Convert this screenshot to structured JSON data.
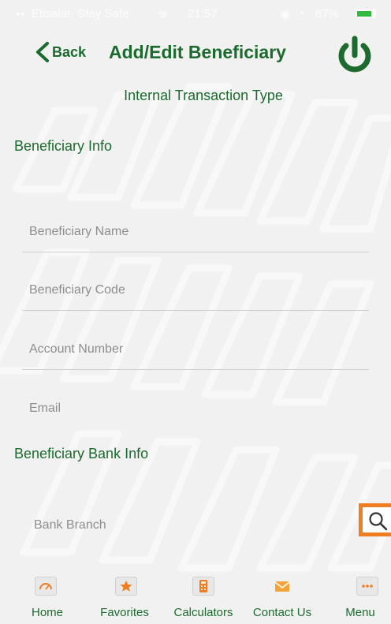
{
  "status_bar": {
    "carrier": "Etisalat- Stay Safe",
    "time": "21:57",
    "battery": "87%"
  },
  "header": {
    "back_label": "Back",
    "title": "Add/Edit Beneficiary"
  },
  "subtitle": "Internal Transaction Type",
  "sections": {
    "beneficiary_info": {
      "title": "Beneficiary Info",
      "fields": [
        {
          "placeholder": "Beneficiary Name"
        },
        {
          "placeholder": "Beneficiary Code"
        },
        {
          "placeholder": "Account Number"
        },
        {
          "placeholder": "Email"
        }
      ]
    },
    "bank_info": {
      "title": "Beneficiary Bank Info",
      "fields": [
        {
          "placeholder": "Bank Branch"
        }
      ]
    }
  },
  "tab_bar": {
    "items": [
      {
        "label": "Home",
        "icon": "speedometer-icon"
      },
      {
        "label": "Favorites",
        "icon": "star-icon"
      },
      {
        "label": "Calculators",
        "icon": "calculator-icon"
      },
      {
        "label": "Contact Us",
        "icon": "envelope-icon"
      },
      {
        "label": "Menu",
        "icon": "ellipsis-icon"
      }
    ]
  },
  "colors": {
    "primary_green": "#1c6a2e",
    "accent_orange": "#ef7d21",
    "background": "#f1f1f1",
    "placeholder_text": "#8e8e8e",
    "status_bar_text": "#ffffff"
  }
}
